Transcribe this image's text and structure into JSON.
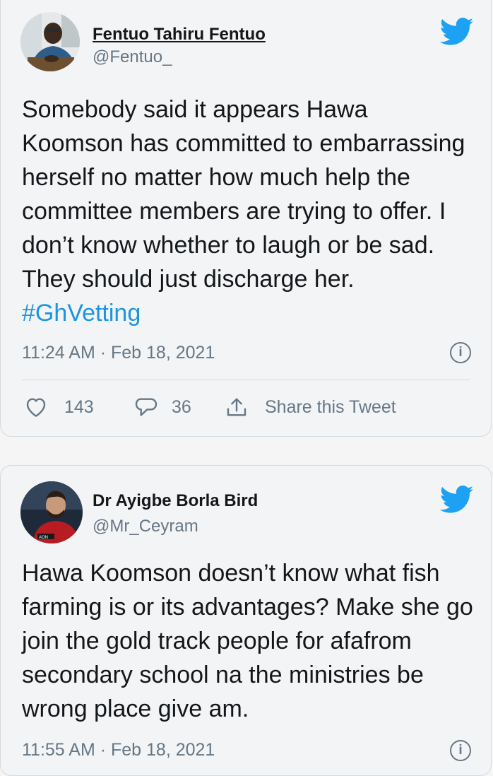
{
  "tweets": [
    {
      "display_name": "Fentuo Tahiru Fentuo",
      "handle": "@Fentuo_",
      "text": "Somebody said it appears Hawa Koomson has committed to embarrassing herself no matter how much help the committee members are trying to offer. I don’t know whether to laugh or be sad. They should just discharge her. ",
      "hashtag": "#GhVetting",
      "timestamp": "11:24 AM · Feb 18, 2021",
      "likes": "143",
      "replies": "36",
      "share_label": "Share this Tweet"
    },
    {
      "display_name": "Dr Ayigbe Borla Bird",
      "handle": "@Mr_Ceyram",
      "text": "Hawa Koomson doesn’t know what fish farming is or its advantages? Make she go join the gold track people for afafrom secondary school na the ministries be wrong place give am.",
      "timestamp": "11:55 AM · Feb 18, 2021"
    }
  ],
  "icons": {
    "brand": "twitter-bird-icon",
    "info": "info-icon",
    "like": "heart-icon",
    "reply": "reply-icon",
    "share": "share-icon"
  },
  "info_glyph": "i",
  "colors": {
    "twitter_blue": "#1da1f2",
    "hashtag": "#1b95e0",
    "secondary_text": "#657786",
    "primary_text": "#14171a"
  }
}
